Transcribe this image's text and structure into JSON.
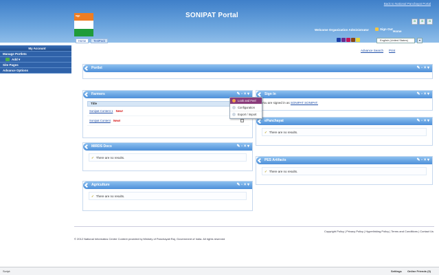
{
  "header": {
    "top_link": "Back to National Panchayat Portal",
    "logo_tag": "ngp",
    "title": "SONIPAT Portal",
    "welcome": "Welcome Organization Administrator",
    "sign_out": "Sign Out",
    "home": "Home",
    "control_icons": [
      "a",
      "a",
      "a"
    ],
    "language": "English (United States)",
    "lang_button": "▾",
    "swatch_colors": [
      "#1d3fa6",
      "#6a2c91",
      "#c2185b",
      "#8b4513",
      "#e8d73c"
    ]
  },
  "tabs": [
    {
      "label": "Home"
    },
    {
      "label": "TestPack"
    }
  ],
  "sidebar": {
    "items": [
      {
        "label": "My Account"
      },
      {
        "label": "Manage Portlets"
      },
      {
        "label": "Add ▾"
      },
      {
        "label": "Site Pages"
      },
      {
        "label": "Advance Options"
      }
    ]
  },
  "tool_links": {
    "advance_search": "Advance Search",
    "print": "Print"
  },
  "portlets": {
    "portlet": {
      "title": "Portlet",
      "actions": "✎ - × ▾"
    },
    "farmers": {
      "title": "Farmers",
      "actions": "✎ - × ▾",
      "column": "Title",
      "rows": [
        {
          "title": "Sonipat Content 1",
          "badge": "New!"
        },
        {
          "title": "Sonipat Content",
          "badge": "New!"
        }
      ]
    },
    "signin": {
      "title": "Sign In",
      "actions": "✎ - × ▾",
      "prefix": "You are signed in as",
      "user": "SONIPAT SONIPAT."
    },
    "panchayat": {
      "title": "ePanchayat",
      "actions": "✎ - × ▾",
      "message": "There are no results."
    },
    "mirds": {
      "title": "MIRDS Docs",
      "actions": "✎ - × ▾",
      "message": "There are no results."
    },
    "pesartifacts": {
      "title": "PES Artifacts",
      "actions": "✎ - × ▾",
      "message": "There are no results."
    },
    "agriculture": {
      "title": "Agriculture",
      "actions": "✎ - × ▾",
      "message": "There are no results."
    }
  },
  "dropdown_menu": {
    "items": [
      {
        "label": "Look and Feel"
      },
      {
        "label": "Configuration"
      },
      {
        "label": "Export / Import"
      }
    ]
  },
  "footer": {
    "links": "Copyright Policy | Privacy Policy | Hyperlinking Policy | Terms and Conditions | Contact Us",
    "copyright": "© 2012 National Informatics Centre Content provided by Ministry of Panchayati Raj, Government of India. All rights reserved"
  },
  "statusbar": {
    "left": "Script:",
    "settings": "Settings",
    "online_friends": "Online Friends (0)"
  }
}
